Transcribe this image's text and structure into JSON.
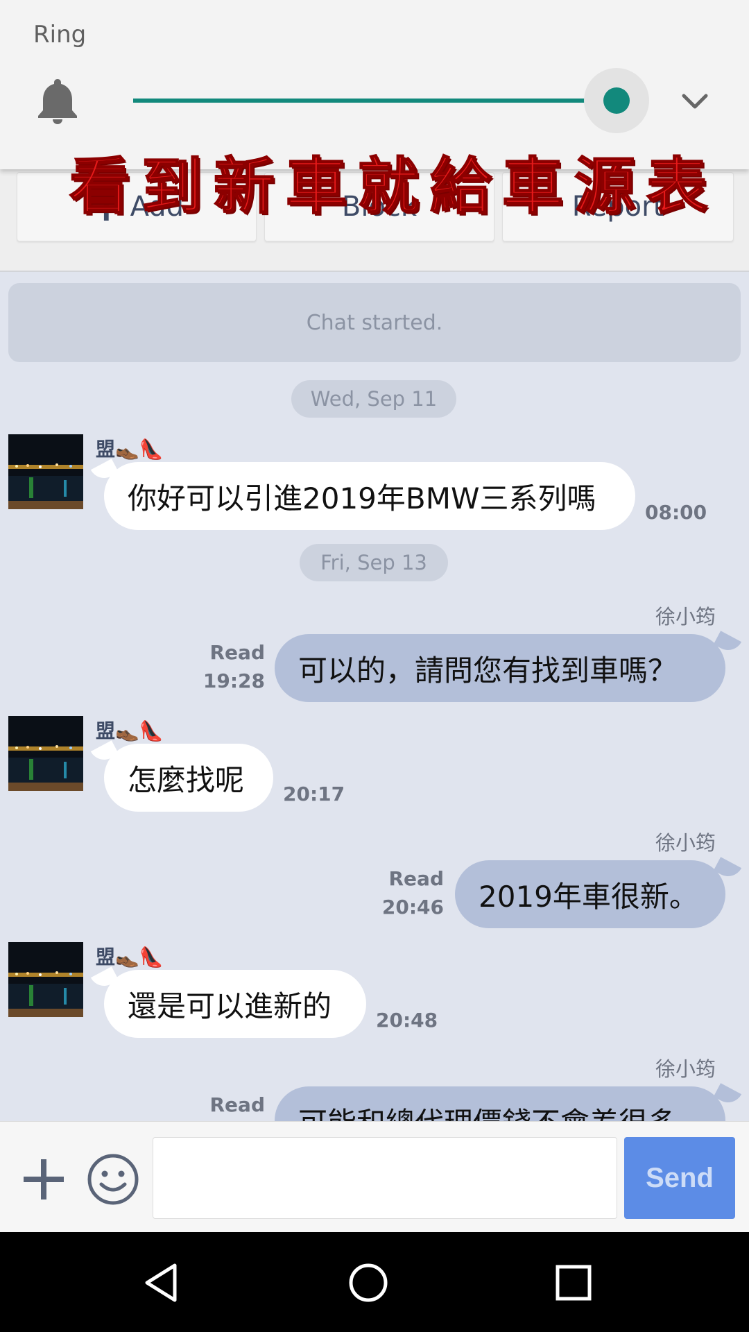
{
  "volume": {
    "label": "Ring",
    "level": 1.0,
    "accent": "#12897c",
    "icons": [
      "bell-icon",
      "chevron-down-icon"
    ]
  },
  "actions": {
    "add_label": "Add",
    "block_label": "Block",
    "report_label": "Report"
  },
  "overlay_caption": "看到新車就給車源表",
  "chat": {
    "started": "Chat started.",
    "date_1": "Wed, Sep 11",
    "date_2": "Fri, Sep 13",
    "contact_name": "盟👞👠",
    "own_name": "徐小筠",
    "read_label": "Read",
    "messages": [
      {
        "from": "contact",
        "text": "你好可以引進2019年BMW三系列嗎",
        "time": "08:00"
      },
      {
        "from": "me",
        "text": "可以的，請問您有找到車嗎？",
        "time": "19:28",
        "status": "Read"
      },
      {
        "from": "contact",
        "text": "怎麼找呢",
        "time": "20:17"
      },
      {
        "from": "me",
        "text": "2019年車很新。",
        "time": "20:46",
        "status": "Read"
      },
      {
        "from": "contact",
        "text": "還是可以進新的",
        "time": "20:48"
      },
      {
        "from": "me",
        "text": "可能和總代理價錢不會差很多",
        "status": "Read"
      }
    ]
  },
  "input": {
    "value": "",
    "send_label": "Send",
    "send_color": "#5c8ce6",
    "icons": [
      "plus-icon",
      "smile-icon"
    ]
  },
  "nav": {
    "icons": [
      "back-icon",
      "home-icon",
      "recents-icon"
    ]
  }
}
